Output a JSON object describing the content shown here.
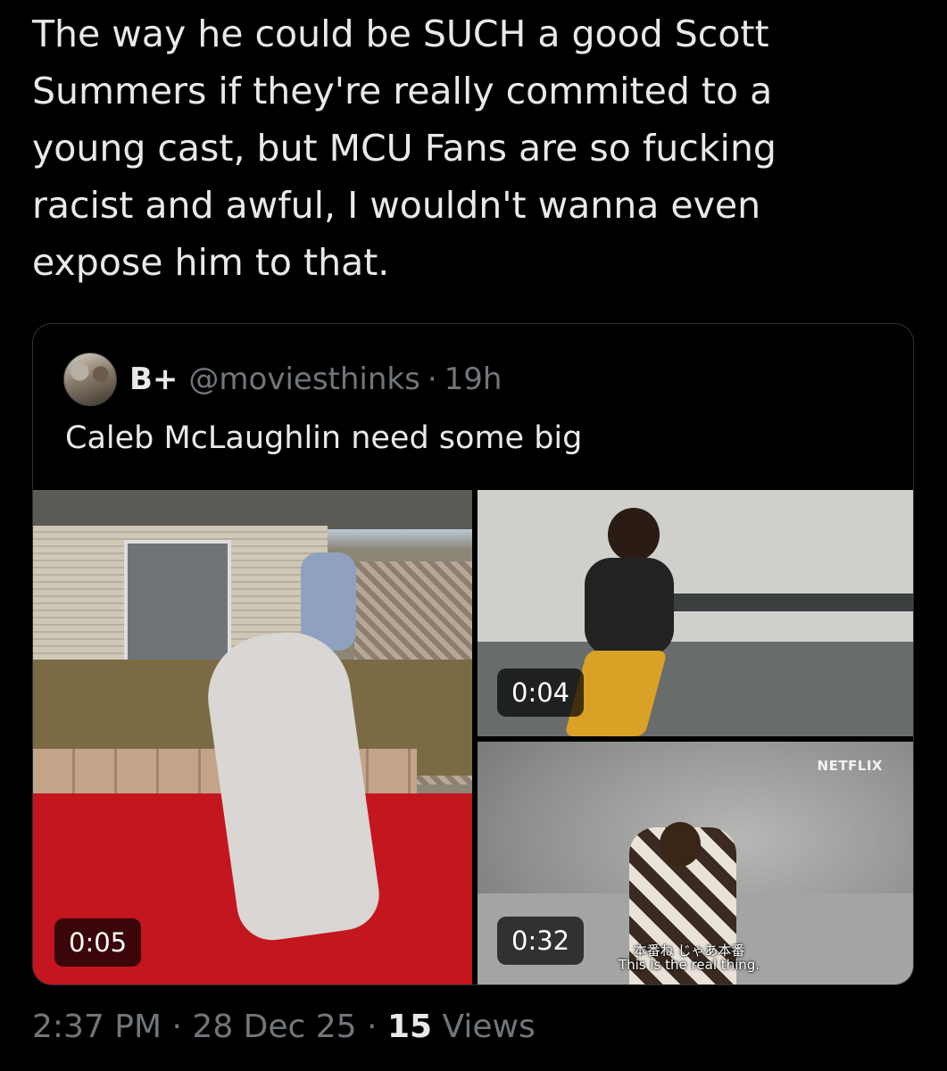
{
  "tweet": {
    "text": "The way he could be SUCH a good Scott\nSummers if they're really commited to a\nyoung cast, but MCU Fans are so fucking\nracist and awful, I wouldn't wanna even\nexpose him to that."
  },
  "quote": {
    "display_name": "B+",
    "handle": "@moviesthinks",
    "separator": "·",
    "time": "19h",
    "text": "Caleb McLaughlin need some big",
    "media": [
      {
        "duration": "0:05"
      },
      {
        "duration": "0:04"
      },
      {
        "duration": "0:32",
        "watermark": "NETFLIX",
        "subtitle_jp": "本番ね じゃあ本番",
        "subtitle_en": "This is the real thing."
      }
    ]
  },
  "meta": {
    "time": "2:37 PM",
    "sep1": "·",
    "date": "28 Dec 25",
    "sep2": "·",
    "views_count": "15",
    "views_label": "Views"
  },
  "colors": {
    "background": "#000000",
    "text": "#e7e9ea",
    "secondary": "#71767b",
    "border": "#2f3336"
  }
}
